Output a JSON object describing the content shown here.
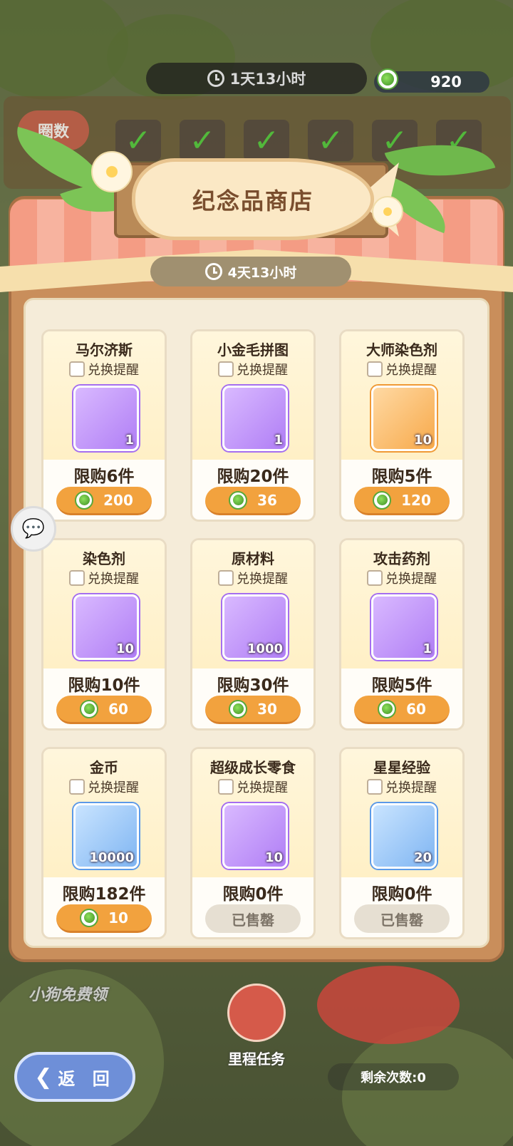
{
  "top_bar": {
    "timer": "1天13小时",
    "currency": "920"
  },
  "laps": {
    "label": "圈数"
  },
  "shop": {
    "title": "纪念品商店",
    "timer": "4天13小时",
    "remind_label": "兑换提醒",
    "items": [
      {
        "name": "马尔济斯",
        "qty": "1",
        "limit": "限购6件",
        "price": "200",
        "rarity": "purple",
        "icon": "maltese-puppy-icon"
      },
      {
        "name": "小金毛拼图",
        "qty": "1",
        "limit": "限购20件",
        "price": "36",
        "rarity": "purple",
        "icon": "golden-puppy-puzzle-icon"
      },
      {
        "name": "大师染色剂",
        "qty": "10",
        "limit": "限购5件",
        "price": "120",
        "rarity": "orange",
        "icon": "rainbow-dye-tube-icon"
      },
      {
        "name": "染色剂",
        "qty": "10",
        "limit": "限购10件",
        "price": "60",
        "rarity": "purple",
        "icon": "dye-tube-icon"
      },
      {
        "name": "原材料",
        "qty": "1000",
        "limit": "限购30件",
        "price": "30",
        "rarity": "purple",
        "icon": "metal-ingot-icon"
      },
      {
        "name": "攻击药剂",
        "qty": "1",
        "limit": "限购5件",
        "price": "60",
        "rarity": "purple",
        "icon": "potion-bottle-icon"
      },
      {
        "name": "金币",
        "qty": "10000",
        "limit": "限购182件",
        "price": "10",
        "rarity": "blue",
        "icon": "gold-coin-icon"
      },
      {
        "name": "超级成长零食",
        "qty": "10",
        "limit": "限购0件",
        "price": "已售罄",
        "rarity": "purple",
        "icon": "cheese-icon",
        "sold_out": true
      },
      {
        "name": "星星经验",
        "qty": "20",
        "limit": "限购0件",
        "price": "已售罄",
        "rarity": "blue",
        "icon": "star-card-icon",
        "sold_out": true
      }
    ]
  },
  "bottom": {
    "back_label": "返 回",
    "remaining": "剩余次数:0",
    "mission_label": "里程任务",
    "free_label": "小狗免费领"
  },
  "colors": {
    "price_orange": "#f2a23e",
    "panel_brown": "#c98e5b",
    "awning_pink": "#f49c84"
  }
}
